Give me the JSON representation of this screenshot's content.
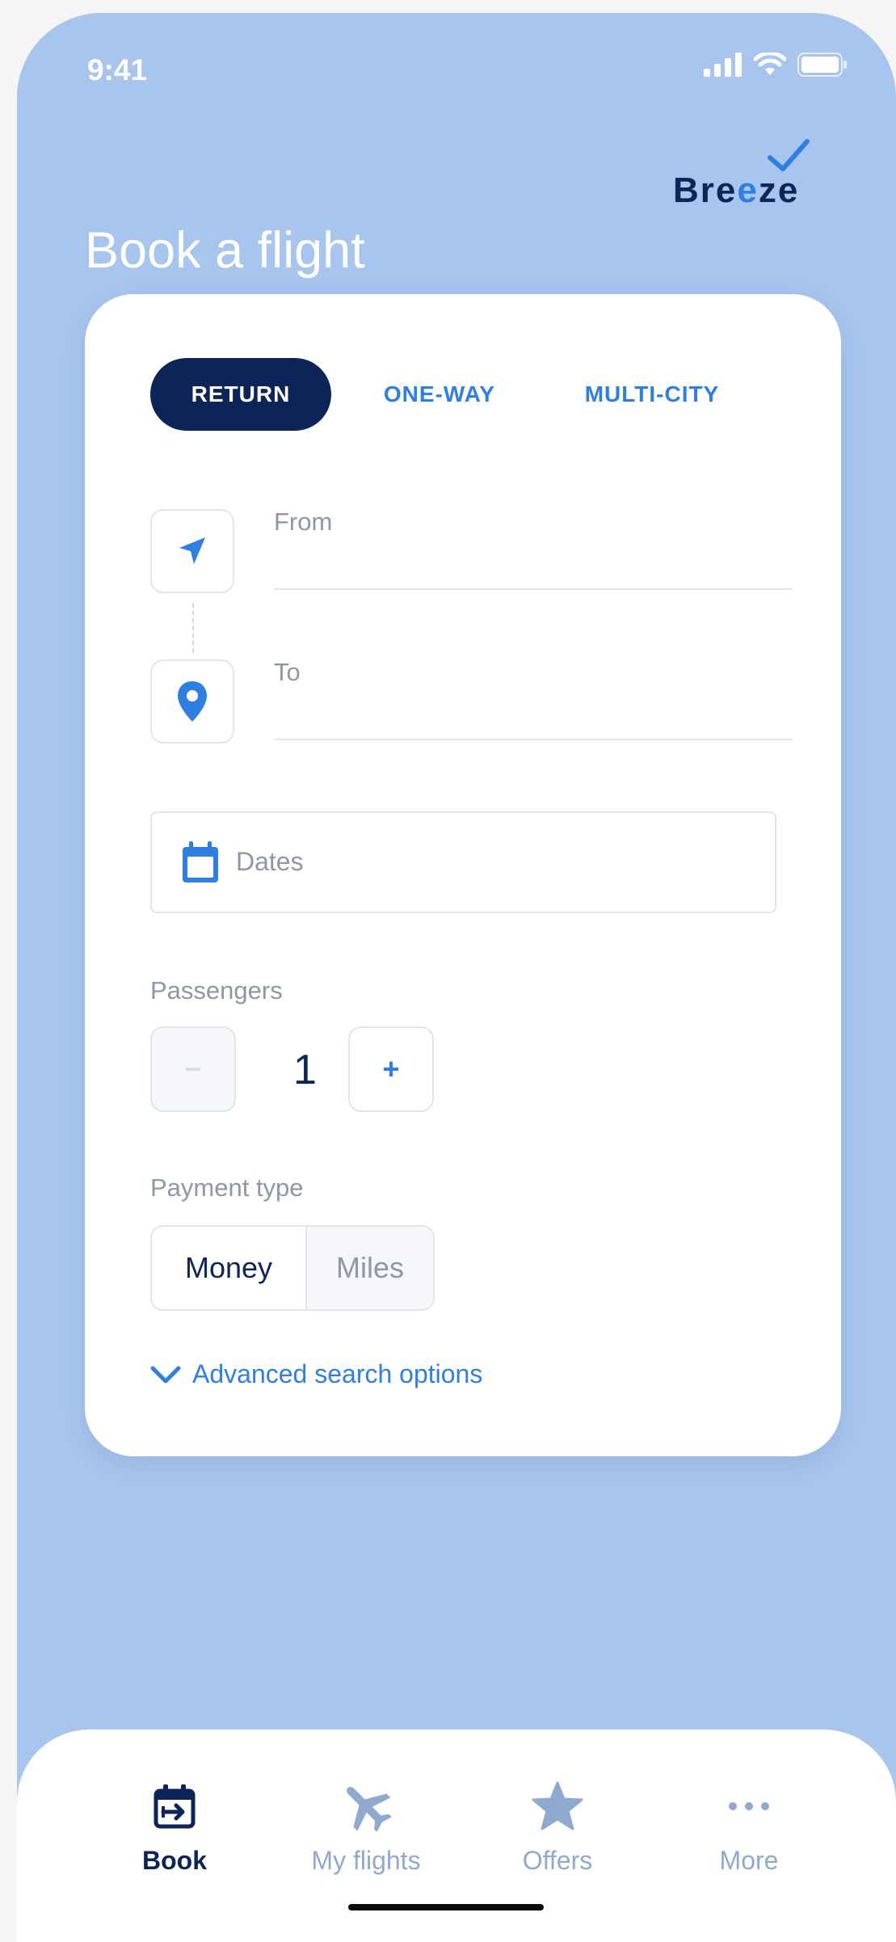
{
  "status_bar": {
    "time": "9:41"
  },
  "brand": {
    "name_before": "Br",
    "name_e1": "e",
    "name_e2": "e",
    "name_mid": "z",
    "name_end": "e"
  },
  "page": {
    "title": "Book a flight"
  },
  "trip_tabs": [
    {
      "label": "RETURN",
      "selected": true
    },
    {
      "label": "ONE-WAY",
      "selected": false
    },
    {
      "label": "MULTI-CITY",
      "selected": false
    }
  ],
  "from_field": {
    "label": "From"
  },
  "to_field": {
    "label": "To"
  },
  "dates_field": {
    "placeholder": "Dates"
  },
  "passengers": {
    "label": "Passengers",
    "count": "1",
    "minus": "−",
    "plus": "+"
  },
  "payment": {
    "label": "Payment type",
    "options": [
      "Money",
      "Miles"
    ],
    "selected": "Money"
  },
  "advanced_search": {
    "label": "Advanced search options"
  },
  "bottom_nav": [
    {
      "label": "Book",
      "icon": "calendar-arrow-icon",
      "active": true
    },
    {
      "label": "My flights",
      "icon": "plane-icon",
      "active": false
    },
    {
      "label": "Offers",
      "icon": "star-icon",
      "active": false
    },
    {
      "label": "More",
      "icon": "more-dots-icon",
      "active": false
    }
  ],
  "colors": {
    "background": "#a7c5ed",
    "navy": "#0d2458",
    "accent_blue": "#2f7fe0",
    "muted_text": "#8e97a6",
    "inactive_nav": "#8fa9cf"
  }
}
